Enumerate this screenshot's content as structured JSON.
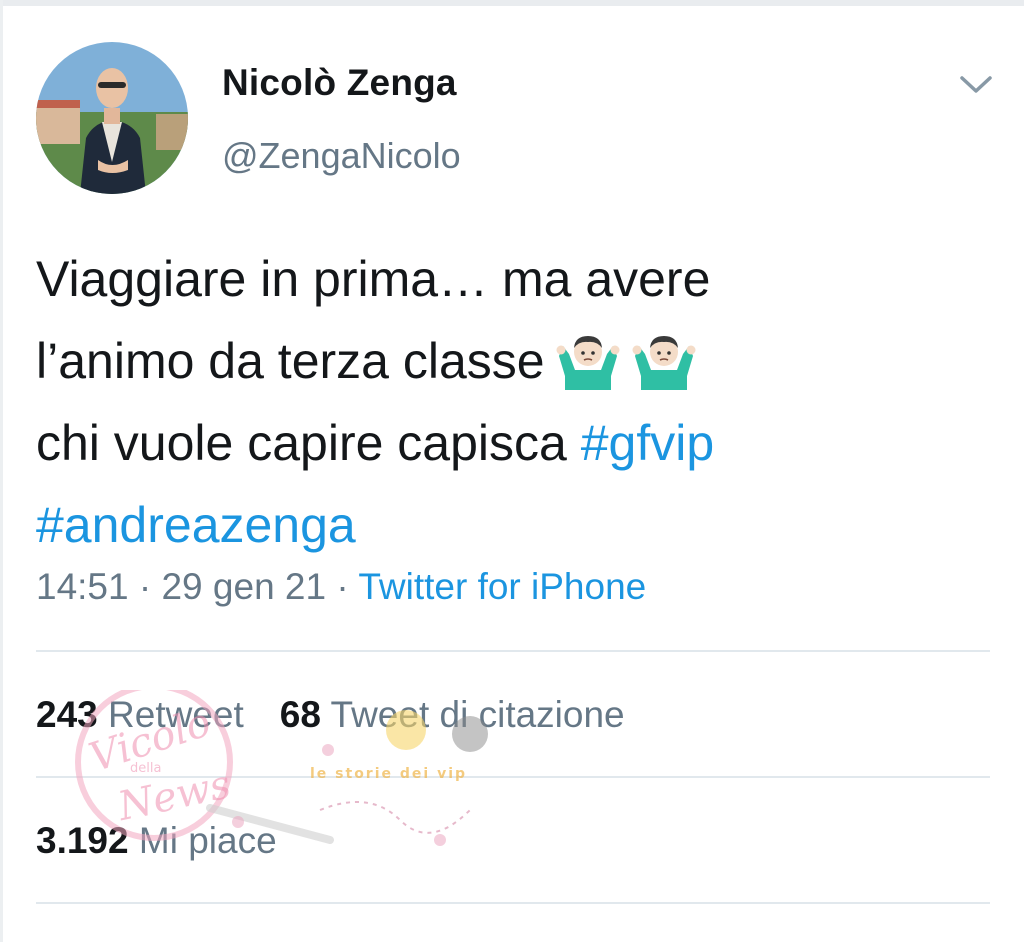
{
  "tweet": {
    "display_name": "Nicolò Zenga",
    "username": "@ZengaNicolo",
    "text_line1": "Viaggiare in prima… ma avere",
    "text_line2": "l’animo da terza classe",
    "text_line3": "chi vuole capire capisca",
    "hashtag1": "#gfvip",
    "hashtag2": "#andreazenga",
    "emoji": "person-shrugging-emoji",
    "time": "14:51",
    "date": "29 gen 21",
    "separator": "·",
    "source": "Twitter for iPhone"
  },
  "stats": {
    "retweet_count": "243",
    "retweet_label": "Retweet",
    "quote_count": "68",
    "quote_label": "Tweet di citazione",
    "like_count": "3.192",
    "like_label": "Mi piace"
  },
  "watermark": {
    "logo_text": "Vicolo della News",
    "tagline": "le storie dei vip"
  },
  "colors": {
    "text": "#14171a",
    "secondary": "#657786",
    "link": "#1b95e0",
    "divider": "#e1e8ed"
  }
}
